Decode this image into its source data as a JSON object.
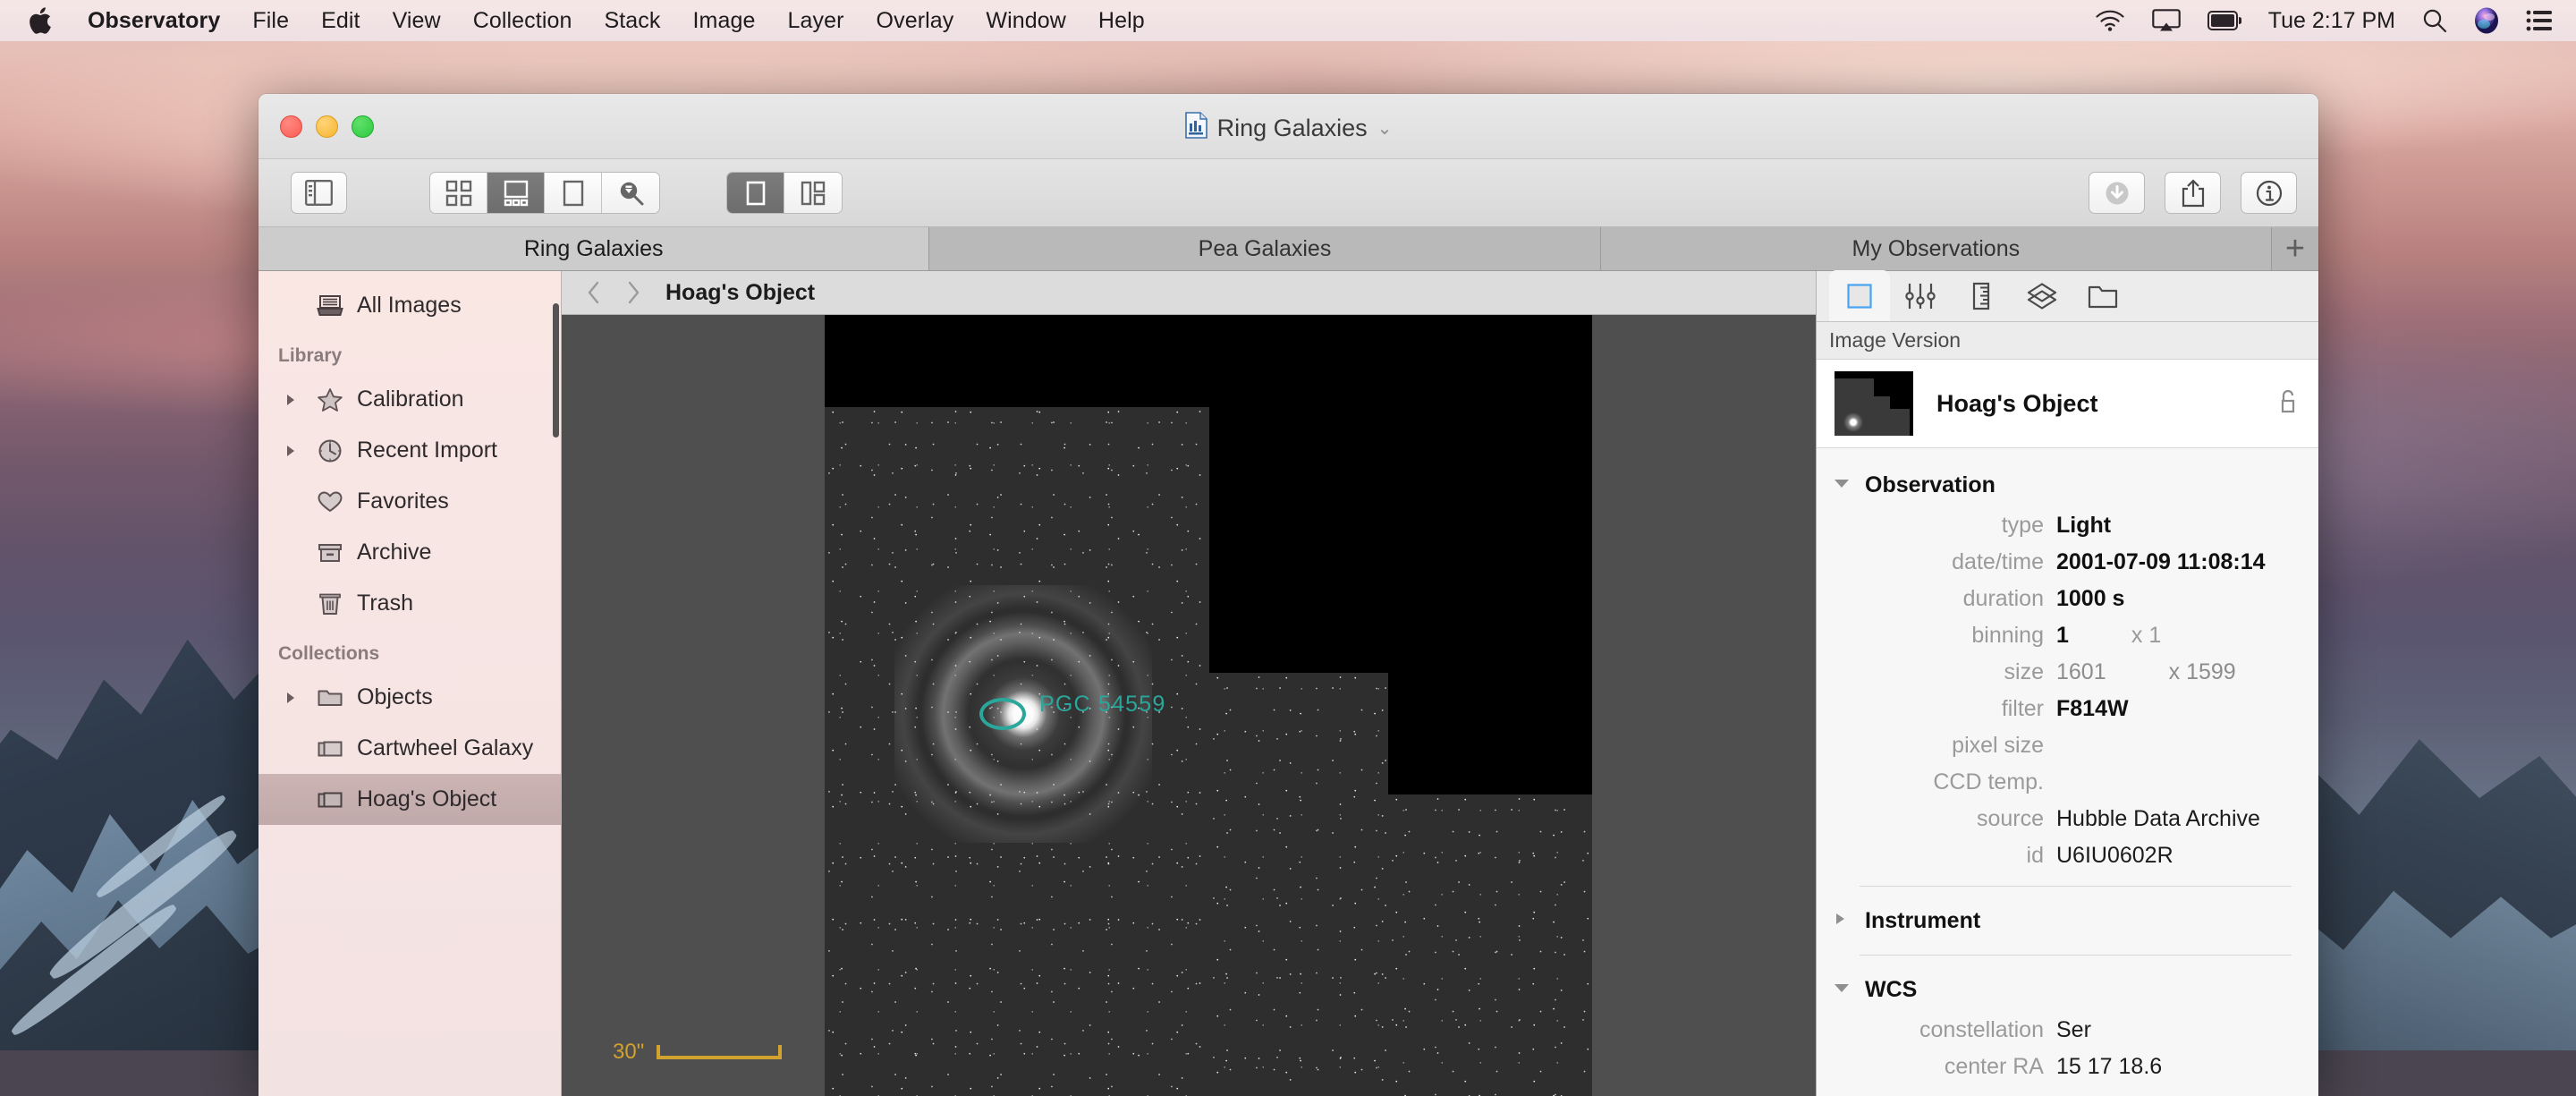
{
  "menubar": {
    "apple_icon": "apple-logo-icon",
    "app_name": "Observatory",
    "items": [
      "File",
      "Edit",
      "View",
      "Collection",
      "Stack",
      "Image",
      "Layer",
      "Overlay",
      "Window",
      "Help"
    ],
    "status": {
      "wifi_icon": "wifi-icon",
      "airplay_icon": "airplay-icon",
      "battery_icon": "battery-icon",
      "clock": "Tue 2:17 PM",
      "search_icon": "spotlight-search-icon",
      "siri_icon": "siri-icon",
      "notifications_icon": "notification-center-icon"
    }
  },
  "window": {
    "title": "Ring Galaxies",
    "title_icon": "document-icon",
    "title_chevron": "⌄",
    "traffic_lights": [
      "close",
      "minimize",
      "zoom"
    ]
  },
  "toolbar": {
    "sidebar_toggle": "sidebar-toggle-icon",
    "view_modes": [
      {
        "name": "grid-view",
        "selected": false
      },
      {
        "name": "filmstrip-view",
        "selected": true
      },
      {
        "name": "single-view",
        "selected": false
      },
      {
        "name": "loupe-search-view",
        "selected": false
      }
    ],
    "layout_modes": [
      {
        "name": "single-pane",
        "selected": true
      },
      {
        "name": "split-pane",
        "selected": false
      }
    ],
    "actions": [
      {
        "name": "download-button",
        "icon": "download-circle-icon"
      },
      {
        "name": "share-button",
        "icon": "share-icon"
      },
      {
        "name": "info-button",
        "icon": "info-circle-icon"
      }
    ]
  },
  "tabs": {
    "items": [
      {
        "label": "Ring Galaxies",
        "active": true
      },
      {
        "label": "Pea Galaxies",
        "active": false
      },
      {
        "label": "My Observations",
        "active": false
      }
    ],
    "add_label": "+"
  },
  "sidebar": {
    "top_item": {
      "label": "All Images",
      "icon": "all-images-icon"
    },
    "sections": [
      {
        "title": "Library",
        "items": [
          {
            "label": "Calibration",
            "icon": "star-icon",
            "disclosure": true,
            "selected": false
          },
          {
            "label": "Recent Import",
            "icon": "clock-icon",
            "disclosure": true,
            "selected": false
          },
          {
            "label": "Favorites",
            "icon": "heart-icon",
            "disclosure": false,
            "selected": false
          },
          {
            "label": "Archive",
            "icon": "archive-box-icon",
            "disclosure": false,
            "selected": false
          },
          {
            "label": "Trash",
            "icon": "trash-icon",
            "disclosure": false,
            "selected": false
          }
        ]
      },
      {
        "title": "Collections",
        "items": [
          {
            "label": "Objects",
            "icon": "folder-icon",
            "disclosure": true,
            "selected": false
          },
          {
            "label": "Cartwheel Galaxy",
            "icon": "stack-icon",
            "disclosure": false,
            "selected": false
          },
          {
            "label": "Hoag's Object",
            "icon": "stack-icon",
            "disclosure": false,
            "selected": true
          }
        ]
      }
    ]
  },
  "breadcrumb": {
    "back_icon": "chevron-left-icon",
    "forward_icon": "chevron-right-icon",
    "title": "Hoag's Object"
  },
  "canvas": {
    "object_label": "PGC 54559",
    "object_label_color": "#2aa79b",
    "scale_label": "30\"",
    "scale_color": "#d2a22e"
  },
  "inspector": {
    "tabs": [
      {
        "name": "image-version-tab",
        "icon": "rectangle-icon",
        "selected": true
      },
      {
        "name": "adjustments-tab",
        "icon": "sliders-icon",
        "selected": false
      },
      {
        "name": "measure-tab",
        "icon": "ruler-icon",
        "selected": false
      },
      {
        "name": "layers-tab",
        "icon": "layers-icon",
        "selected": false
      },
      {
        "name": "files-tab",
        "icon": "folder-icon",
        "selected": false
      }
    ],
    "subhead": "Image Version",
    "hero": {
      "title": "Hoag's Object",
      "lock_icon": "unlocked-padlock-icon"
    },
    "groups": [
      {
        "name": "Observation",
        "expanded": true,
        "rows": [
          {
            "key": "type",
            "value": "Light",
            "style": "bold"
          },
          {
            "key": "date/time",
            "value": "2001-07-09 11:08:14",
            "style": "bold"
          },
          {
            "key": "duration",
            "value": "1000 s",
            "style": "bold"
          },
          {
            "key": "binning",
            "value": "1",
            "value2": "x 1",
            "style": "bold"
          },
          {
            "key": "size",
            "value": "1601",
            "value2": "x 1599",
            "style": "dim"
          },
          {
            "key": "filter",
            "value": "F814W",
            "style": "bold"
          },
          {
            "key": "pixel size",
            "value": "",
            "style": "dim"
          },
          {
            "key": "CCD temp.",
            "value": "",
            "style": "dim"
          },
          {
            "key": "source",
            "value": "Hubble Data Archive",
            "style": "plain"
          },
          {
            "key": "id",
            "value": "U6IU0602R",
            "style": "plain"
          }
        ]
      },
      {
        "name": "Instrument",
        "expanded": false,
        "rows": []
      },
      {
        "name": "WCS",
        "expanded": true,
        "rows": [
          {
            "key": "constellation",
            "value": "Ser",
            "style": "plain"
          },
          {
            "key": "center RA",
            "value": "15 17 18.6",
            "style": "plain"
          }
        ]
      }
    ]
  }
}
